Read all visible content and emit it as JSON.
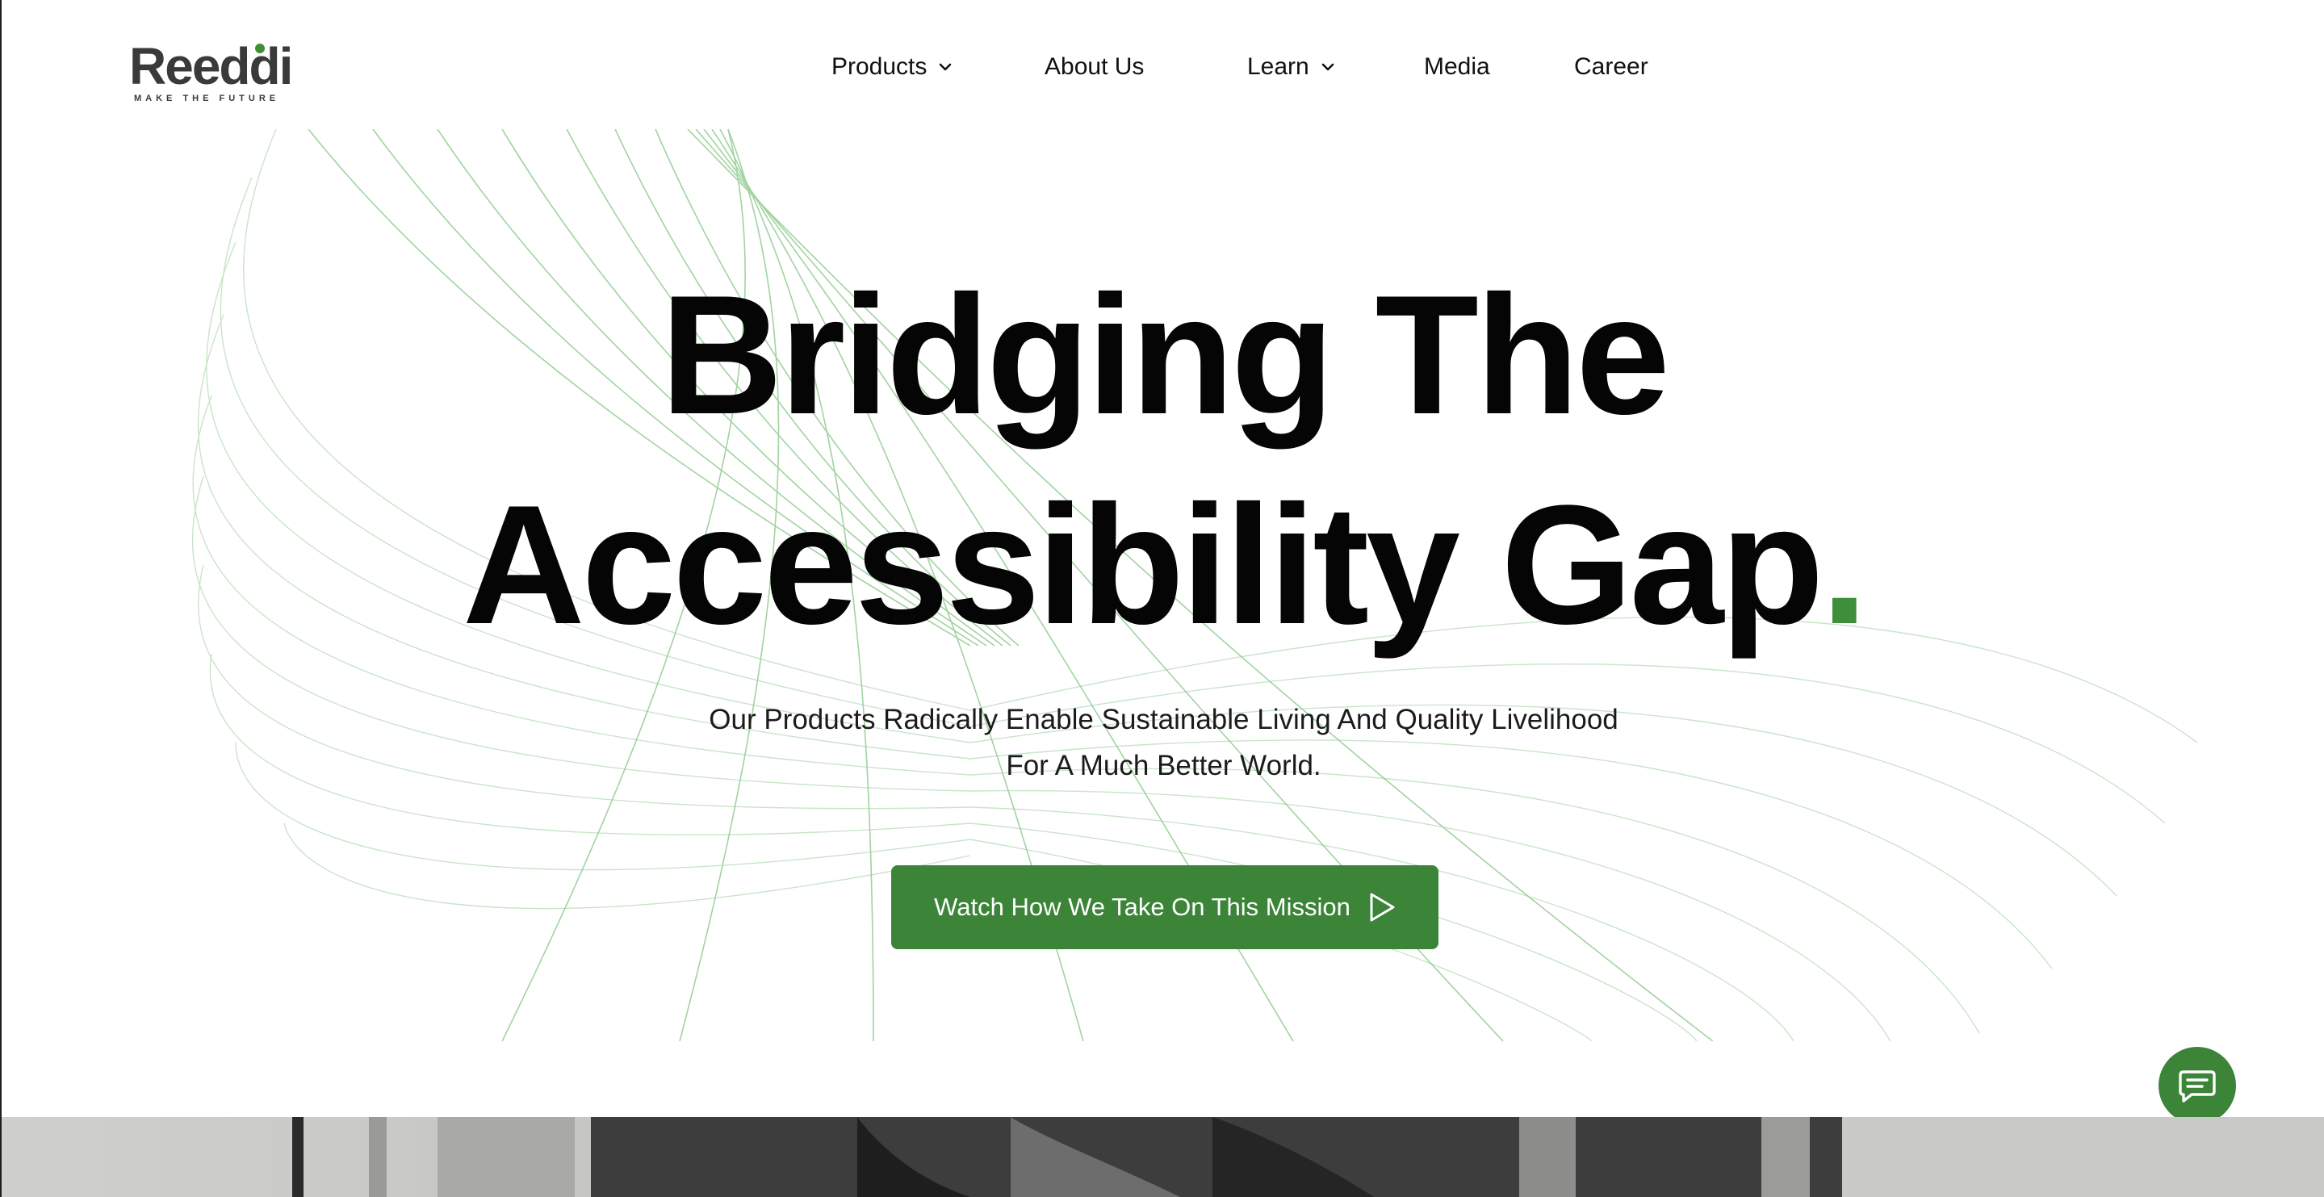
{
  "brand": {
    "name": "Reeddi",
    "tagline": "MAKE THE FUTURE",
    "accent_color": "#3f8f3a"
  },
  "nav": {
    "items": [
      {
        "label": "Products",
        "has_dropdown": true
      },
      {
        "label": "About Us",
        "has_dropdown": false
      },
      {
        "label": "Learn",
        "has_dropdown": true
      },
      {
        "label": "Media",
        "has_dropdown": false
      },
      {
        "label": "Career",
        "has_dropdown": false
      }
    ]
  },
  "hero": {
    "headline_line1": "Bridging The",
    "headline_line2": "Accessibility Gap",
    "headline_dot": ".",
    "subtitle_line1": "Our Products Radically Enable Sustainable Living And Quality Livelihood",
    "subtitle_line2": "For A Much Better World.",
    "cta_label": "Watch How We Take On This Mission",
    "cta_icon": "play-icon"
  },
  "chat": {
    "icon": "chat-icon",
    "color": "#3b8438"
  }
}
